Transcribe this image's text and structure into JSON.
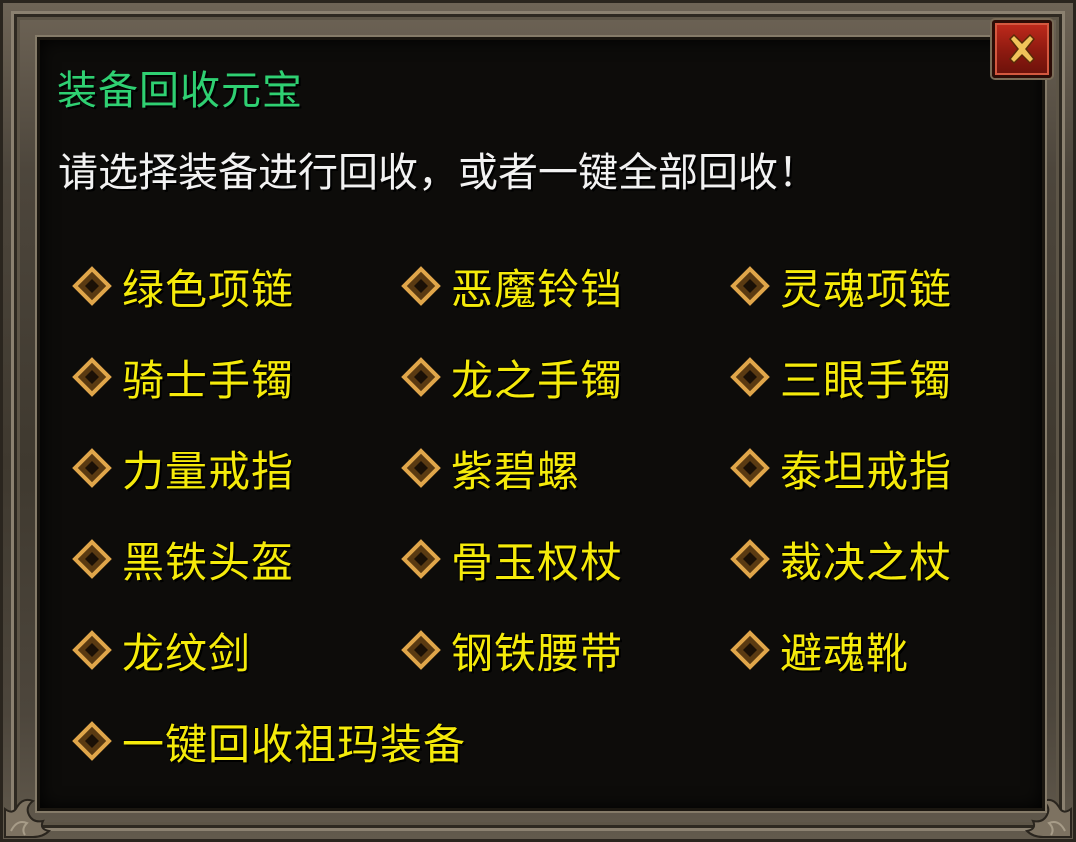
{
  "dialog": {
    "title": "装备回收元宝",
    "instruction": "请选择装备进行回收，或者一键全部回收！",
    "close_icon": "close-icon"
  },
  "items": [
    {
      "label": "绿色项链"
    },
    {
      "label": "恶魔铃铛"
    },
    {
      "label": "灵魂项链"
    },
    {
      "label": "骑士手镯"
    },
    {
      "label": "龙之手镯"
    },
    {
      "label": "三眼手镯"
    },
    {
      "label": "力量戒指"
    },
    {
      "label": "紫碧螺"
    },
    {
      "label": "泰坦戒指"
    },
    {
      "label": "黑铁头盔"
    },
    {
      "label": "骨玉权杖"
    },
    {
      "label": "裁决之杖"
    },
    {
      "label": "龙纹剑"
    },
    {
      "label": "钢铁腰带"
    },
    {
      "label": "避魂靴"
    },
    {
      "label": "一键回收祖玛装备"
    }
  ],
  "colors": {
    "title": "#2fd072",
    "instruction": "#f2f2f2",
    "item_text": "#f5ea0a",
    "bullet": "#d89a3a",
    "close_button": "#a82418"
  }
}
